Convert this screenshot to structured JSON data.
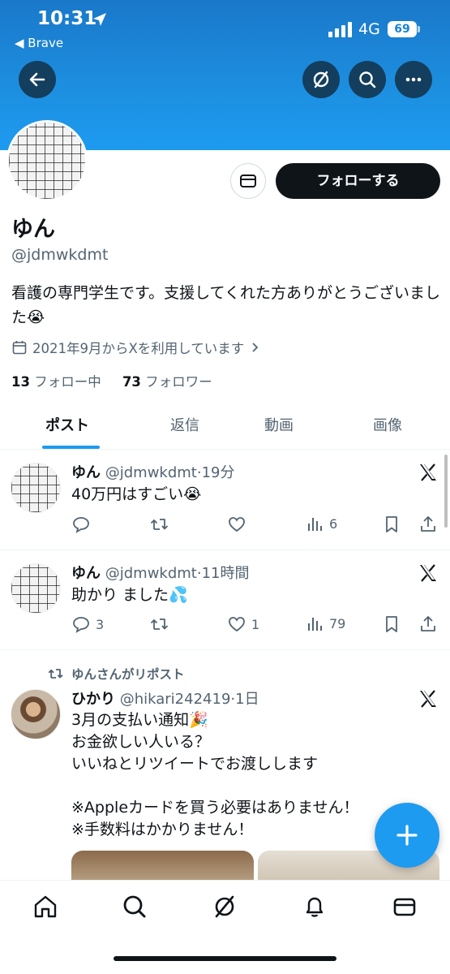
{
  "status_bar": {
    "time": "10:31",
    "back_app": "◀ Brave",
    "network": "4G",
    "battery": "69"
  },
  "profile": {
    "name": "ゆん",
    "handle": "@jdmwkdmt",
    "bio": "看護の専門学生です。支援してくれた方ありがとうございました😭",
    "joined": "2021年9月からXを利用しています",
    "following_count": "13",
    "following_label": "フォロー中",
    "followers_count": "73",
    "followers_label": "フォロワー",
    "follow_button": "フォローする"
  },
  "tabs": [
    "ポスト",
    "返信",
    "動画",
    "画像"
  ],
  "posts": [
    {
      "name": "ゆん",
      "handle": "@jdmwkdmt",
      "time": "19分",
      "text": "40万円はすごい😭",
      "replies": "",
      "reposts": "",
      "likes": "",
      "views": "6"
    },
    {
      "name": "ゆん",
      "handle": "@jdmwkdmt",
      "time": "11時間",
      "text": "助かり ました💦",
      "replies": "3",
      "reposts": "",
      "likes": "1",
      "views": "79"
    },
    {
      "repost_label": "ゆんさんがリポスト",
      "name": "ひかり",
      "handle": "@hikari242419",
      "time": "1日",
      "text": "3月の支払い通知🎉\nお金欲しい人いる？\nいいねとリツイートでお渡しします\n\n※Appleカードを買う必要はありません！\n※手数料はかかりません！"
    }
  ],
  "colors": {
    "accent": "#1d9bf0",
    "banner": "#1d8fe0",
    "text": "#0f1419",
    "muted": "#536471"
  }
}
